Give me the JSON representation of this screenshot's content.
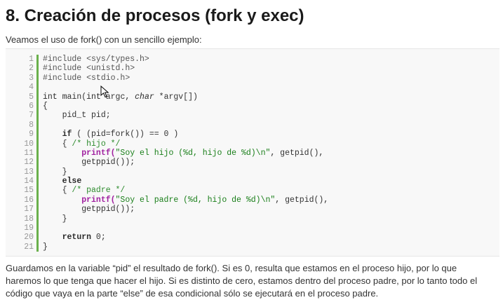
{
  "title": "8. Creación de procesos (fork y exec)",
  "intro": "Veamos el uso de fork() con un sencillo ejemplo:",
  "code": {
    "line_numbers": [
      "1",
      "2",
      "3",
      "4",
      "5",
      "6",
      "7",
      "8",
      "9",
      "10",
      "11",
      "12",
      "13",
      "14",
      "15",
      "16",
      "17",
      "18",
      "19",
      "20",
      "21"
    ],
    "lines": [
      [
        {
          "t": "#include <sys/types.h>",
          "c": "t-pre"
        }
      ],
      [
        {
          "t": "#include <unistd.h>",
          "c": "t-pre"
        }
      ],
      [
        {
          "t": "#include <stdio.h>",
          "c": "t-pre"
        }
      ],
      [],
      [
        {
          "t": "int ",
          "c": "t-type"
        },
        {
          "t": "main(",
          "c": "t-plain"
        },
        {
          "t": "int ",
          "c": "t-type"
        },
        {
          "t": "argc, ",
          "c": "t-plain"
        },
        {
          "t": "char ",
          "c": "t-italic-type"
        },
        {
          "t": "*argv[])",
          "c": "t-plain"
        }
      ],
      [
        {
          "t": "{",
          "c": "t-plain"
        }
      ],
      [
        {
          "t": "    pid_t pid;",
          "c": "t-plain"
        }
      ],
      [],
      [
        {
          "t": "    ",
          "c": "t-plain"
        },
        {
          "t": "if",
          "c": "t-kw"
        },
        {
          "t": " ( (pid=fork()) == 0 )",
          "c": "t-plain"
        }
      ],
      [
        {
          "t": "    { ",
          "c": "t-plain"
        },
        {
          "t": "/* hijo */",
          "c": "t-cm"
        }
      ],
      [
        {
          "t": "        ",
          "c": "t-plain"
        },
        {
          "t": "printf(",
          "c": "t-func"
        },
        {
          "t": "\"Soy el hijo (%d, hijo de %d)\\n\"",
          "c": "t-str"
        },
        {
          "t": ", getpid(),",
          "c": "t-plain"
        }
      ],
      [
        {
          "t": "        getppid());",
          "c": "t-plain"
        }
      ],
      [
        {
          "t": "    }",
          "c": "t-plain"
        }
      ],
      [
        {
          "t": "    ",
          "c": "t-plain"
        },
        {
          "t": "else",
          "c": "t-kw"
        }
      ],
      [
        {
          "t": "    { ",
          "c": "t-plain"
        },
        {
          "t": "/* padre */",
          "c": "t-cm"
        }
      ],
      [
        {
          "t": "        ",
          "c": "t-plain"
        },
        {
          "t": "printf(",
          "c": "t-func"
        },
        {
          "t": "\"Soy el padre (%d, hijo de %d)\\n\"",
          "c": "t-str"
        },
        {
          "t": ", getpid(),",
          "c": "t-plain"
        }
      ],
      [
        {
          "t": "        getppid());",
          "c": "t-plain"
        }
      ],
      [
        {
          "t": "    }",
          "c": "t-plain"
        }
      ],
      [],
      [
        {
          "t": "    ",
          "c": "t-plain"
        },
        {
          "t": "return",
          "c": "t-kw"
        },
        {
          "t": " 0;",
          "c": "t-plain"
        }
      ],
      [
        {
          "t": "}",
          "c": "t-plain"
        }
      ]
    ]
  },
  "footer_lines": [
    "Guardamos en la variable “pid” el resultado de fork(). Si es 0, resulta que estamos en el proceso hijo, por lo que",
    "haremos lo que tenga que hacer el hijo. Si es distinto de cero, estamos dentro del proceso padre, por lo tanto todo el",
    "código que vaya en la parte “else” de esa condicional sólo se ejecutará en el proceso padre."
  ],
  "colors": {
    "gutter_bar": "#6ab04c",
    "string": "#1a7f1a",
    "function": "#a020a0",
    "comment": "#2e8b2e"
  },
  "icons": {
    "cursor": "mouse-pointer-icon"
  }
}
